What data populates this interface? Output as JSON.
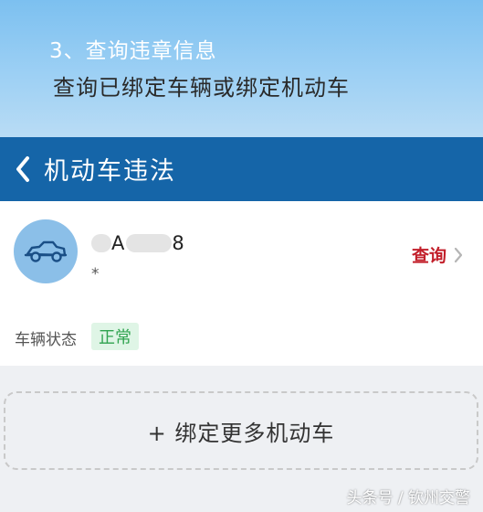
{
  "banner": {
    "step": "3、查询违章信息",
    "desc": "查询已绑定车辆或绑定机动车"
  },
  "navbar": {
    "title": "机动车违法",
    "back_icon": "chevron-left-icon"
  },
  "vehicle": {
    "icon": "car-icon",
    "plate_a": "A",
    "plate_b": "8",
    "sub": "*",
    "query_label": "查询",
    "status_label": "车辆状态",
    "status_value": "正常"
  },
  "actions": {
    "bind_more": "+ 绑定更多机动车"
  },
  "watermark": "头条号 / 钦州交警",
  "colors": {
    "nav": "#1565a8",
    "query": "#c21f2a",
    "status": "#2fa34f",
    "avatar": "#8bbfe8"
  }
}
